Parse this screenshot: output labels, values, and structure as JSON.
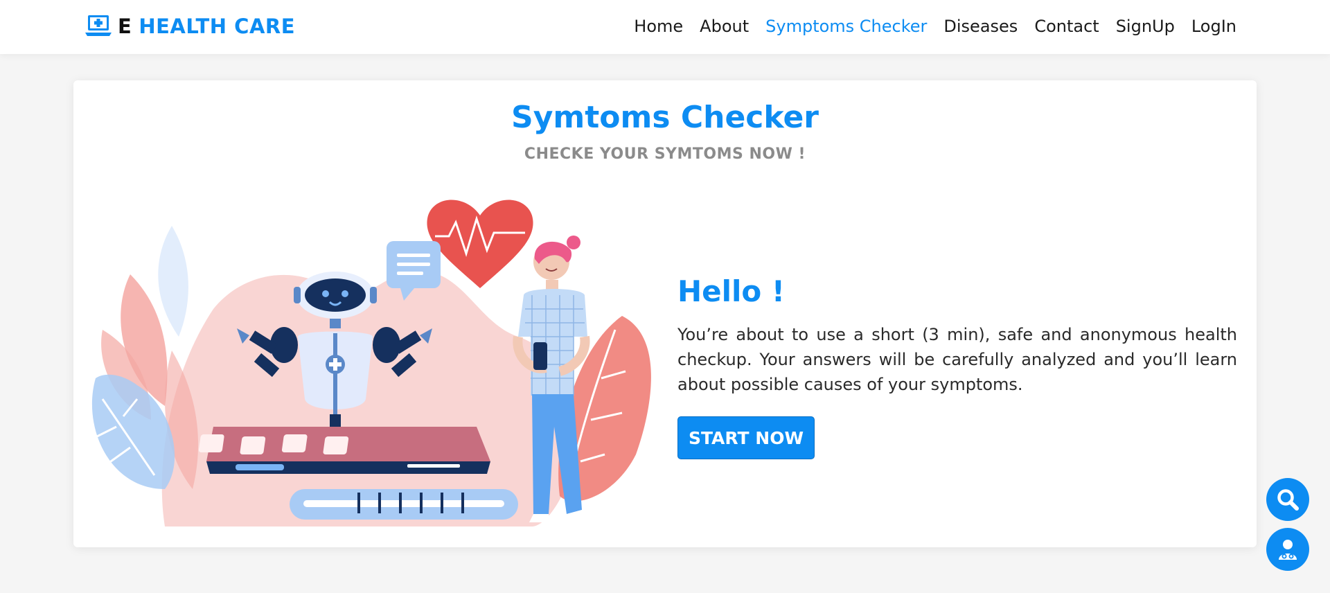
{
  "brand": {
    "prefix": "E",
    "name": "HEALTH CARE",
    "icon": "laptop-medical-icon"
  },
  "nav": {
    "items": [
      {
        "label": "Home",
        "active": false
      },
      {
        "label": "About",
        "active": false
      },
      {
        "label": "Symptoms Checker",
        "active": true
      },
      {
        "label": "Diseases",
        "active": false
      },
      {
        "label": "Contact",
        "active": false
      },
      {
        "label": "SignUp",
        "active": false
      },
      {
        "label": "LogIn",
        "active": false
      }
    ]
  },
  "hero": {
    "title": "Symtoms Checker",
    "subtitle": "CHECKE YOUR SYMTOMS NOW !",
    "greeting": "Hello !",
    "description": "You’re about to use a short (3 min), safe and anonymous health checkup. Your answers will be carefully analyzed and you’ll learn about possible causes of your symptoms.",
    "button_label": "START NOW",
    "illustration": "robot-doctor-illustration"
  },
  "floating_buttons": {
    "search_icon": "search-icon",
    "doctor_icon": "doctor-icon"
  },
  "colors": {
    "accent": "#0d8cf2",
    "subtitle_gray": "#8b8b8b"
  }
}
